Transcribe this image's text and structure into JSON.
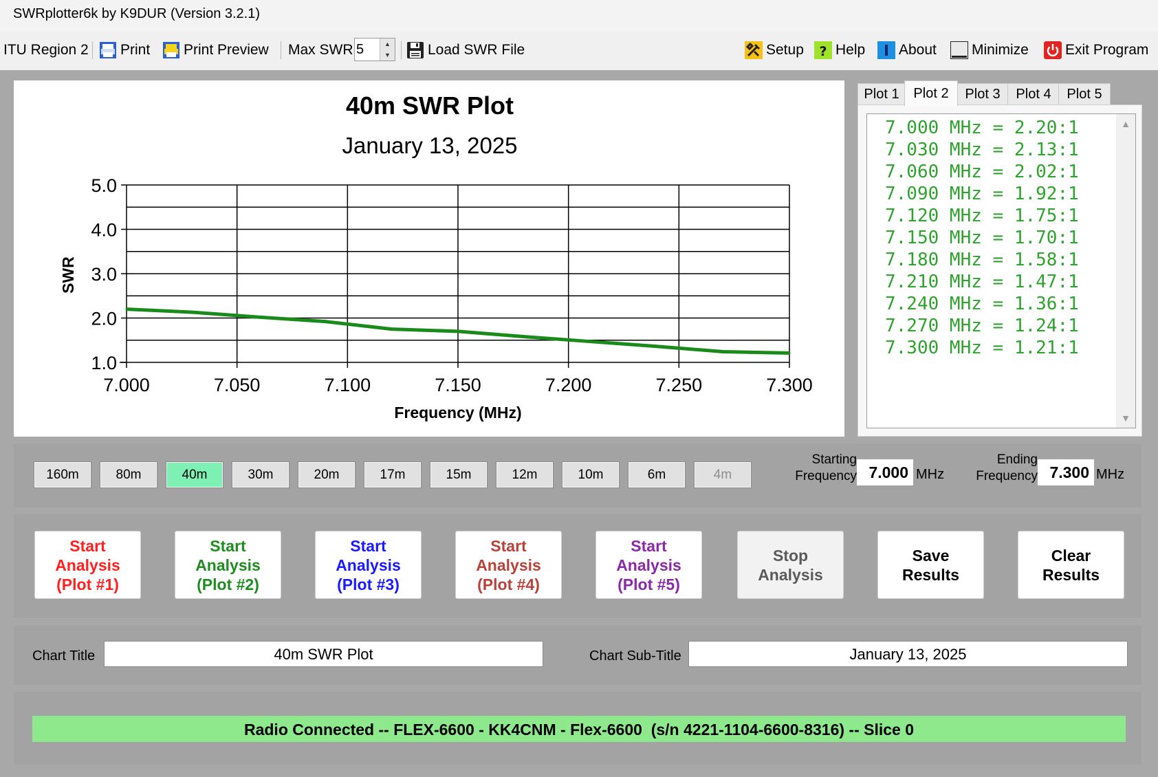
{
  "window": {
    "title": "SWRplotter6k by K9DUR (Version 3.2.1)"
  },
  "toolbar": {
    "region": "ITU Region 2",
    "print": "Print",
    "print_preview": "Print Preview",
    "max_swr_label": "Max SWR",
    "max_swr_value": "5",
    "load_swr_file": "Load SWR File",
    "setup": "Setup",
    "help": "Help",
    "about": "About",
    "minimize": "Minimize",
    "exit": "Exit Program",
    "icons": [
      "printer-icon",
      "print-preview-icon",
      "floppy-disk-icon",
      "tools-icon",
      "help-icon",
      "info-icon",
      "minimize-icon",
      "power-icon"
    ]
  },
  "chart_data": {
    "type": "line",
    "title": "40m SWR Plot",
    "subtitle": "January 13, 2025",
    "xlabel": "Frequency (MHz)",
    "ylabel": "SWR",
    "xlim": [
      7.0,
      7.3
    ],
    "ylim": [
      1.0,
      5.0
    ],
    "xticks": [
      "7.000",
      "7.050",
      "7.100",
      "7.150",
      "7.200",
      "7.250",
      "7.300"
    ],
    "yticks": [
      "1.0",
      "2.0",
      "3.0",
      "4.0",
      "5.0"
    ],
    "grid": true,
    "line_color": "#1a8a1a",
    "series": [
      {
        "x": [
          7.0,
          7.03,
          7.06,
          7.09,
          7.12,
          7.15,
          7.18,
          7.21,
          7.24,
          7.27,
          7.3
        ],
        "values": [
          2.2,
          2.13,
          2.02,
          1.92,
          1.75,
          1.7,
          1.58,
          1.47,
          1.36,
          1.24,
          1.21
        ]
      }
    ]
  },
  "tabs": [
    "Plot 1",
    "Plot 2",
    "Plot 3",
    "Plot 4",
    "Plot 5"
  ],
  "active_tab": "Plot 2",
  "readings": [
    "7.000 MHz = 2.20:1",
    "7.030 MHz = 2.13:1",
    "7.060 MHz = 2.02:1",
    "7.090 MHz = 1.92:1",
    "7.120 MHz = 1.75:1",
    "7.150 MHz = 1.70:1",
    "7.180 MHz = 1.58:1",
    "7.210 MHz = 1.47:1",
    "7.240 MHz = 1.36:1",
    "7.270 MHz = 1.24:1",
    "7.300 MHz = 1.21:1"
  ],
  "bands": {
    "items": [
      "160m",
      "80m",
      "40m",
      "30m",
      "20m",
      "17m",
      "15m",
      "12m",
      "10m",
      "6m",
      "4m"
    ],
    "active": "40m",
    "disabled": [
      "4m"
    ],
    "active_color": "#7ff0b4"
  },
  "freq": {
    "start_label": "Starting Frequency",
    "start_value": "7.000",
    "end_label": "Ending Frequency",
    "end_value": "7.300",
    "unit": "MHz"
  },
  "analysis": {
    "buttons": [
      {
        "lines": [
          "Start",
          "Analysis",
          "(Plot #1)"
        ],
        "color": "#ff2020"
      },
      {
        "lines": [
          "Start",
          "Analysis",
          "(Plot #2)"
        ],
        "color": "#1e8c1e"
      },
      {
        "lines": [
          "Start",
          "Analysis",
          "(Plot #3)"
        ],
        "color": "#1a1aff"
      },
      {
        "lines": [
          "Start",
          "Analysis",
          "(Plot #4)"
        ],
        "color": "#b8423a"
      },
      {
        "lines": [
          "Start",
          "Analysis",
          "(Plot #5)"
        ],
        "color": "#8a28a8"
      }
    ],
    "stop_lines": [
      "Stop",
      "Analysis"
    ],
    "save_lines": [
      "Save",
      "Results"
    ],
    "clear_lines": [
      "Clear",
      "Results"
    ]
  },
  "chart_fields": {
    "title_label": "Chart Title",
    "title_value": "40m SWR Plot",
    "subtitle_label": "Chart Sub-Title",
    "subtitle_value": "January 13, 2025"
  },
  "status": {
    "text": "Radio Connected -- FLEX-6600 - KK4CNM - Flex-6600  (s/n 4221-1104-6600-8316) -- Slice 0",
    "color": "#8ee88c"
  }
}
